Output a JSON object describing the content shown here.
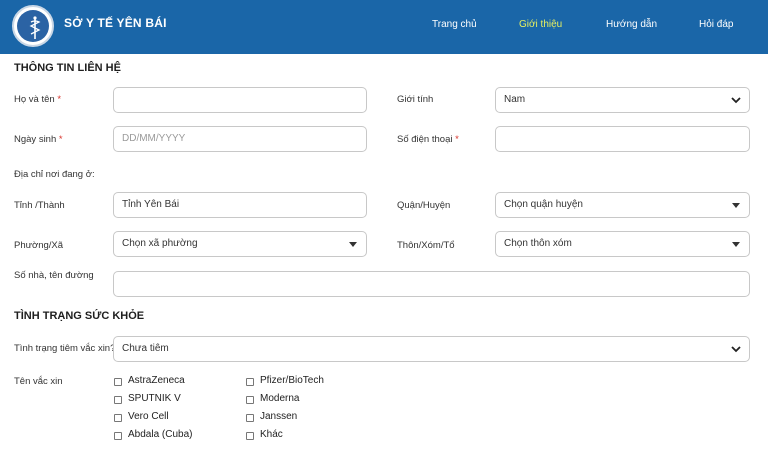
{
  "header": {
    "brand": "SỞ Y TẾ YÊN BÁI",
    "nav": [
      "Trang chủ",
      "Giới thiệu",
      "Hướng dẫn",
      "Hỏi đáp"
    ],
    "active_nav": "Giới thiệu",
    "bg_color": "#1a66a8",
    "active_color": "#e8f060"
  },
  "contact": {
    "title": "THÔNG TIN LIÊN HỆ",
    "name_label": "Họ và tên",
    "name_value": "",
    "gender_label": "Giới tính",
    "gender_value": "Nam",
    "dob_label": "Ngày sinh",
    "dob_placeholder": "DD/MM/YYYY",
    "phone_label": "Số điện thoại",
    "phone_value": "",
    "address_label": "Địa chỉ nơi đang ở:",
    "province_label": "Tỉnh /Thành",
    "province_value": "Tỉnh Yên Bái",
    "district_label": "Quận/Huyện",
    "district_value": "Chọn quận huyện",
    "ward_label": "Phường/Xã",
    "ward_value": "Chọn xã phường",
    "hamlet_label": "Thôn/Xóm/Tổ",
    "hamlet_value": "Chọn thôn xóm",
    "street_label": "Số nhà, tên đường",
    "street_value": "",
    "required_mark": "*"
  },
  "health": {
    "title": "TÌNH TRẠNG SỨC KHỎE",
    "vacc_status_label": "Tình trạng tiêm vắc xin?",
    "vacc_status_value": "Chưa tiêm",
    "vaccine_label": "Tên vắc xin",
    "vaccines_col1": [
      "AstraZeneca",
      "SPUTNIK V",
      "Vero Cell",
      "Abdala (Cuba)"
    ],
    "vaccines_col2": [
      "Pfizer/BioTech",
      "Moderna",
      "Janssen",
      "Khác"
    ]
  }
}
